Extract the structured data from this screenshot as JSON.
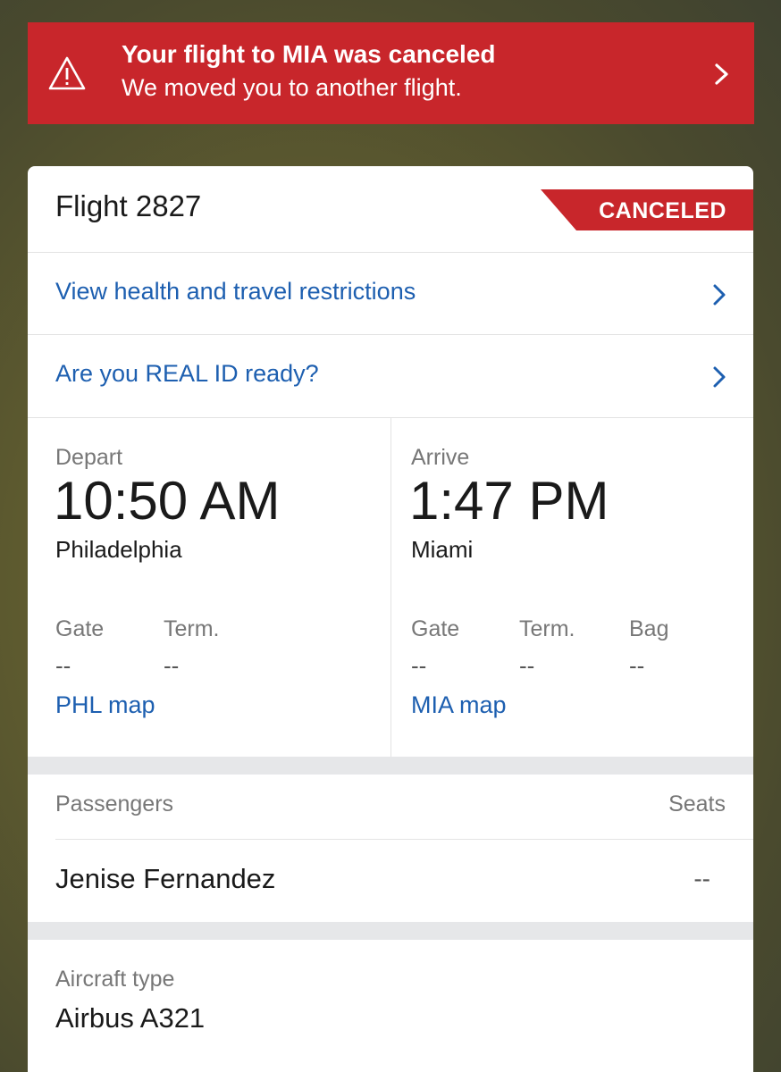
{
  "alert": {
    "title": "Your flight to MIA was canceled",
    "subtitle": "We moved you to another flight.",
    "icon": "warning-icon",
    "color": "#c8262b"
  },
  "flight": {
    "title": "Flight 2827",
    "status": "CANCELED"
  },
  "links": {
    "health": "View health and travel restrictions",
    "realid": "Are you REAL ID ready?"
  },
  "depart": {
    "label": "Depart",
    "time": "10:50 AM",
    "city": "Philadelphia",
    "gate_label": "Gate",
    "gate_value": "--",
    "term_label": "Term.",
    "term_value": "--",
    "map_link": "PHL map"
  },
  "arrive": {
    "label": "Arrive",
    "time": "1:47 PM",
    "city": "Miami",
    "gate_label": "Gate",
    "gate_value": "--",
    "term_label": "Term.",
    "term_value": "--",
    "bag_label": "Bag",
    "bag_value": "--",
    "map_link": "MIA map"
  },
  "passengers": {
    "header": "Passengers",
    "seats_header": "Seats",
    "list": [
      {
        "name": "Jenise Fernandez",
        "seat": "--"
      }
    ]
  },
  "aircraft": {
    "label": "Aircraft type",
    "value": "Airbus A321"
  }
}
